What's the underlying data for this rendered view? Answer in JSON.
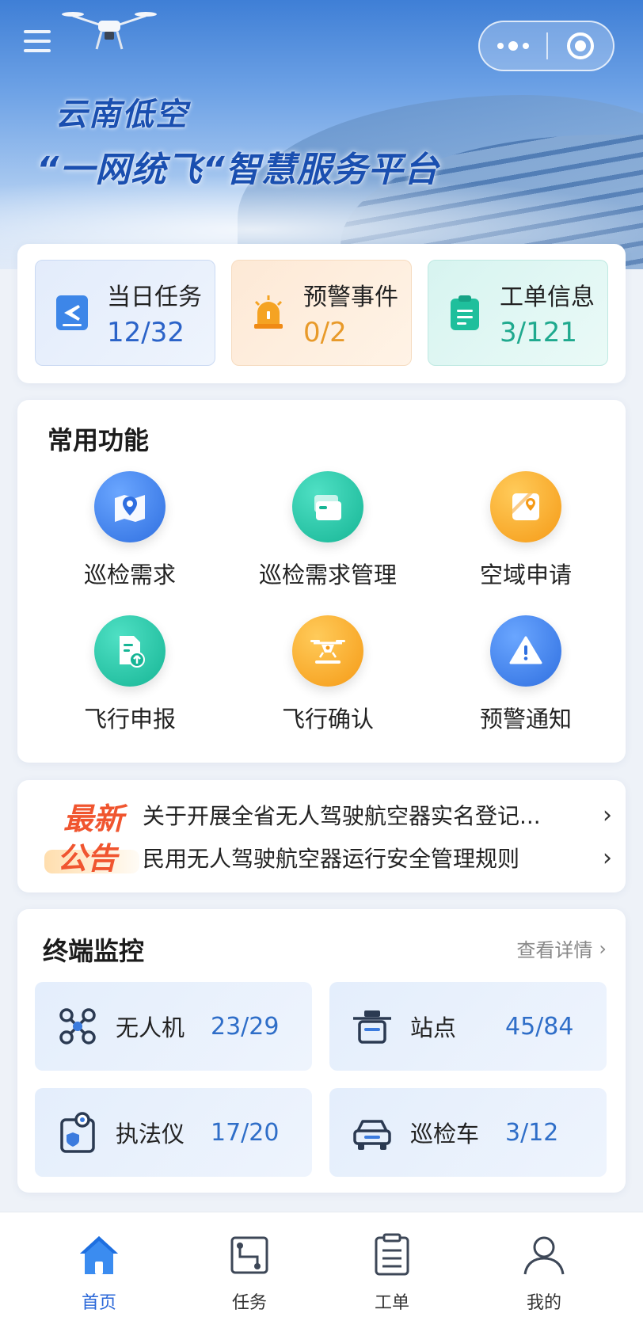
{
  "header": {
    "title": "云南低空",
    "subtitle": "“一网统飞“智慧服务平台"
  },
  "stats": [
    {
      "label": "当日任务",
      "value": "12/32",
      "icon": "flight-doc-icon"
    },
    {
      "label": "预警事件",
      "value": "0/2",
      "icon": "siren-icon"
    },
    {
      "label": "工单信息",
      "value": "3/121",
      "icon": "clipboard-icon"
    }
  ],
  "functions": {
    "title": "常用功能",
    "items": [
      {
        "label": "巡检需求",
        "icon": "map-pin-icon"
      },
      {
        "label": "巡检需求管理",
        "icon": "folder-icon"
      },
      {
        "label": "空域申请",
        "icon": "map-location-icon"
      },
      {
        "label": "飞行申报",
        "icon": "file-upload-icon"
      },
      {
        "label": "飞行确认",
        "icon": "drone-icon"
      },
      {
        "label": "预警通知",
        "icon": "warning-icon"
      }
    ]
  },
  "notice": {
    "badge_line1": "最新",
    "badge_line2": "公告",
    "items": [
      "关于开展全省无人驾驶航空器实名登记...",
      "民用无人驾驶航空器运行安全管理规则"
    ]
  },
  "monitor": {
    "title": "终端监控",
    "detail_link": "查看详情",
    "items": [
      {
        "label": "无人机",
        "value": "23/29",
        "icon": "drone-icon"
      },
      {
        "label": "站点",
        "value": "45/84",
        "icon": "station-icon"
      },
      {
        "label": "执法仪",
        "value": "17/20",
        "icon": "camera-icon"
      },
      {
        "label": "巡检车",
        "value": "3/12",
        "icon": "car-icon"
      }
    ]
  },
  "tabbar": [
    {
      "label": "首页",
      "icon": "home-icon",
      "active": true
    },
    {
      "label": "任务",
      "icon": "task-icon",
      "active": false
    },
    {
      "label": "工单",
      "icon": "work-order-icon",
      "active": false
    },
    {
      "label": "我的",
      "icon": "user-icon",
      "active": false
    }
  ],
  "colors": {
    "primary": "#2a67d8",
    "orange": "#e89a2a",
    "teal": "#1fa98e",
    "notice": "#f0552f"
  }
}
